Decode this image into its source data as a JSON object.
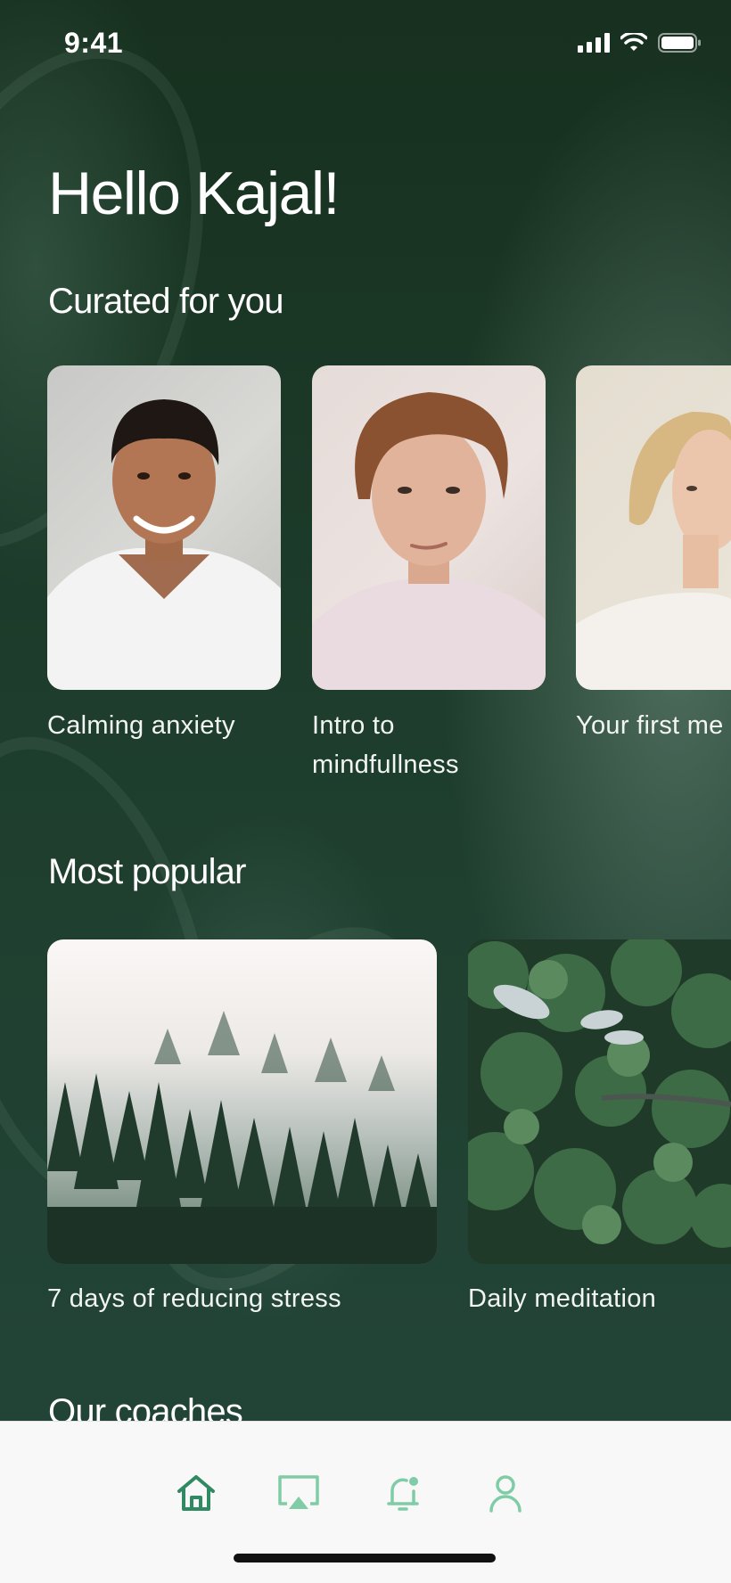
{
  "status_bar": {
    "time": "9:41"
  },
  "greeting": "Hello Kajal!",
  "curated": {
    "title": "Curated for you",
    "items": [
      {
        "label": "Calming anxiety"
      },
      {
        "label": "Intro to mindfullness"
      },
      {
        "label": "Your first me"
      }
    ]
  },
  "popular": {
    "title": "Most popular",
    "items": [
      {
        "label": "7 days of reducing stress"
      },
      {
        "label": "Daily meditation"
      }
    ]
  },
  "coaches": {
    "title": "Our coaches"
  },
  "tabbar": {
    "items": [
      {
        "icon": "home-icon"
      },
      {
        "icon": "airplay-icon"
      },
      {
        "icon": "notification-bell-icon"
      },
      {
        "icon": "profile-icon"
      }
    ]
  },
  "colors": {
    "accent": "#3a9a6e",
    "background": "#1c3a2c",
    "tabbar": "#f8f8f8"
  }
}
